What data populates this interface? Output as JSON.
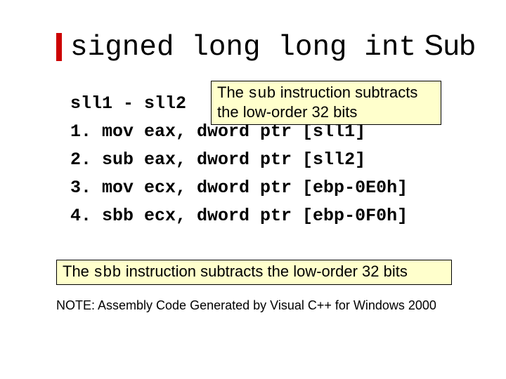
{
  "title": {
    "mono": "signed long long int",
    "sans": " Sub"
  },
  "code": {
    "l0": "sll1 - sll2",
    "l1": "1. mov eax, dword ptr [sll1]",
    "l2": "2. sub eax, dword ptr [sll2]",
    "l3": "3. mov ecx, dword ptr [ebp-0E0h]",
    "l4": "4. sbb ecx, dword ptr [ebp-0F0h]"
  },
  "callout_top": {
    "pre": "The ",
    "mono": "sub",
    "post": " instruction subtracts the low-order 32 bits"
  },
  "callout_bot": {
    "pre": "The ",
    "mono": "sbb",
    "post": " instruction subtracts the low-order 32 bits"
  },
  "note": "NOTE:  Assembly Code Generated by Visual C++ for Windows 2000"
}
